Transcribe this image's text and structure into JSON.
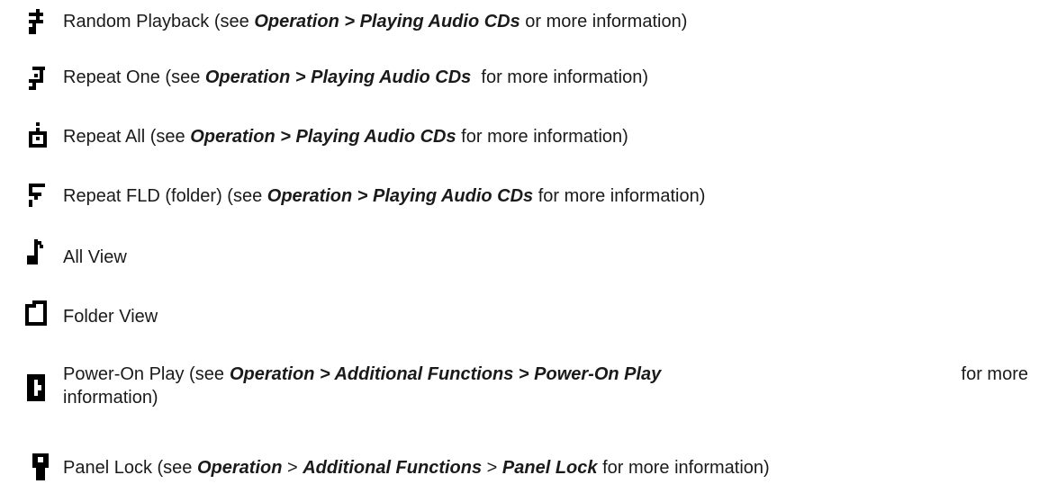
{
  "items": [
    {
      "icon": "random-playback-icon",
      "prefix": "Random Playback (see ",
      "bold1": "Operation > Playing Audio CDs",
      "suffix": " or more information)"
    },
    {
      "icon": "repeat-one-icon",
      "prefix": "Repeat One (see ",
      "bold1": "Operation > Playing Audio CDs",
      "suffix": "  for more information)"
    },
    {
      "icon": "repeat-all-icon",
      "prefix": "Repeat All (see ",
      "bold1": "Operation > Playing Audio CDs",
      "suffix": " for more information)"
    },
    {
      "icon": "repeat-folder-icon",
      "prefix": "Repeat FLD (folder) (see ",
      "bold1": "Operation > Playing Audio CDs",
      "suffix": " for more information)"
    },
    {
      "icon": "all-view-icon",
      "label": "All View"
    },
    {
      "icon": "folder-view-icon",
      "label": "Folder View"
    },
    {
      "icon": "power-on-play-icon",
      "line1_prefix": "Power-On Play (see ",
      "line1_bold": "Operation > Additional Functions > Power-On Play",
      "line1_suffix": " for more",
      "line2": "information)"
    },
    {
      "icon": "panel-lock-icon",
      "prefix": "Panel Lock (see ",
      "b1": "Operation",
      "sep1": " > ",
      "b2": "Additional Functions",
      "sep2": " > ",
      "b3": "Panel Lock",
      "suffix": " for more information)"
    }
  ]
}
